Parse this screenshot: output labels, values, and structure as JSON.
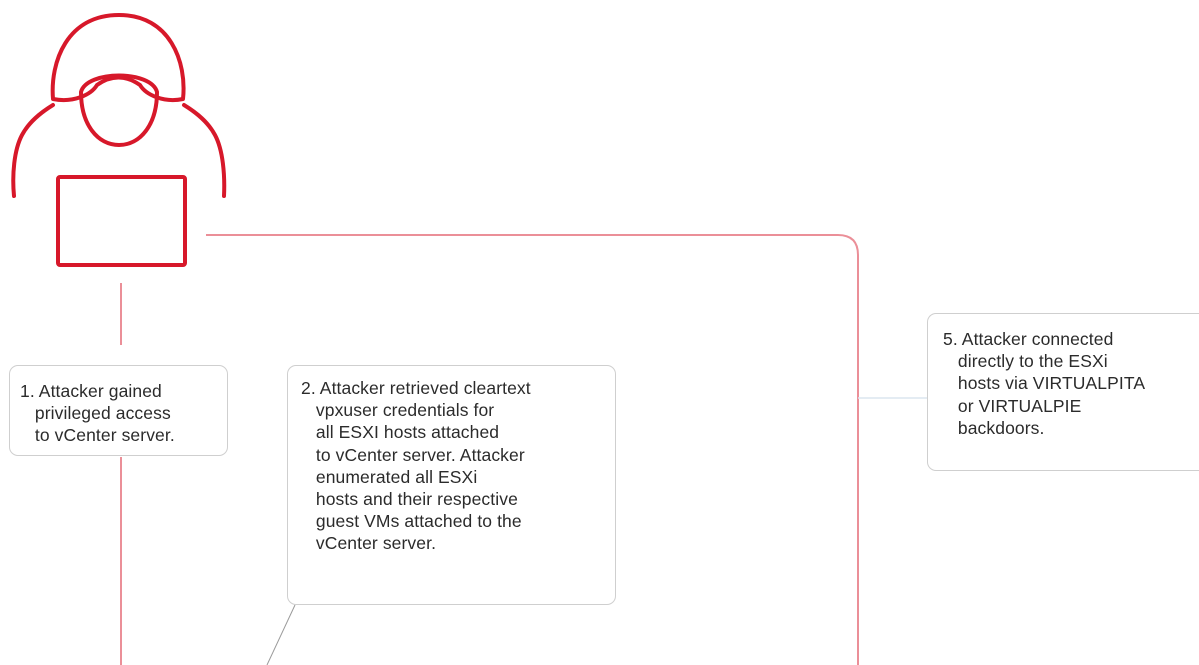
{
  "colors": {
    "accent": "#d7182a",
    "accent_light": "#eb8f98",
    "note_border": "#cfcfcf",
    "connector_light": "#dbe6ef",
    "connector_gray": "#9a9a9a",
    "text": "#2b2b2b"
  },
  "icons": {
    "attacker": "hooded-attacker-laptop-icon"
  },
  "steps": [
    {
      "id": "step-1",
      "lines": [
        "1. Attacker gained",
        "   privileged access",
        "   to vCenter server."
      ]
    },
    {
      "id": "step-2",
      "lines": [
        "2. Attacker retrieved cleartext",
        "   vpxuser credentials for",
        "   all ESXI hosts attached",
        "   to vCenter server. Attacker",
        "   enumerated all ESXi",
        "   hosts and their respective",
        "   guest VMs attached to the",
        "   vCenter server."
      ]
    },
    {
      "id": "step-5",
      "lines": [
        "5. Attacker connected",
        "   directly to the ESXi",
        "   hosts via VIRTUALPITA",
        "   or VIRTUALPIE",
        "   backdoors."
      ]
    }
  ]
}
